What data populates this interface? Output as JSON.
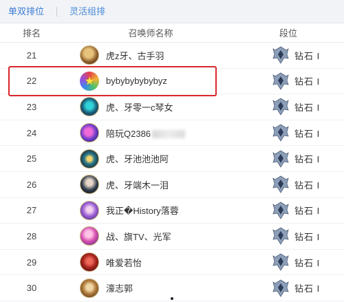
{
  "tabs": [
    {
      "label": "单双排位"
    },
    {
      "label": "灵活组排"
    }
  ],
  "header": {
    "rank": "排名",
    "name": "召唤师名称",
    "tier": "段位"
  },
  "rows": [
    {
      "rank": "21",
      "name": "虎z牙、古手羽",
      "tier": "钻石 I",
      "avatar": "avatar-gold"
    },
    {
      "rank": "22",
      "name": "bybybybybybyz",
      "tier": "钻石 I",
      "avatar": "avatar-star"
    },
    {
      "rank": "23",
      "name": "虎、牙零一c琴女",
      "tier": "钻石 I",
      "avatar": "avatar-teal"
    },
    {
      "rank": "24",
      "name": "陪玩Q2386",
      "tier": "钻石 I",
      "avatar": "avatar-purple"
    },
    {
      "rank": "25",
      "name": "虎、牙池池池阿",
      "tier": "钻石 I",
      "avatar": "avatar-gear"
    },
    {
      "rank": "26",
      "name": "虎、牙端木一泪",
      "tier": "钻石 I",
      "avatar": "avatar-dark"
    },
    {
      "rank": "27",
      "name": "我正�History落蓉",
      "tier": "钻石 I",
      "avatar": "avatar-violet"
    },
    {
      "rank": "28",
      "name": "战、旗TV、光军",
      "tier": "钻石 I",
      "avatar": "avatar-pink"
    },
    {
      "rank": "29",
      "name": "唯爱若怡",
      "tier": "钻石 I",
      "avatar": "avatar-red"
    },
    {
      "rank": "30",
      "name": "濠志郭",
      "tier": "钻石 I",
      "avatar": "avatar-brown"
    }
  ],
  "colors": {
    "tab_text": "#3a7bd5",
    "highlight": "#d9262a"
  }
}
